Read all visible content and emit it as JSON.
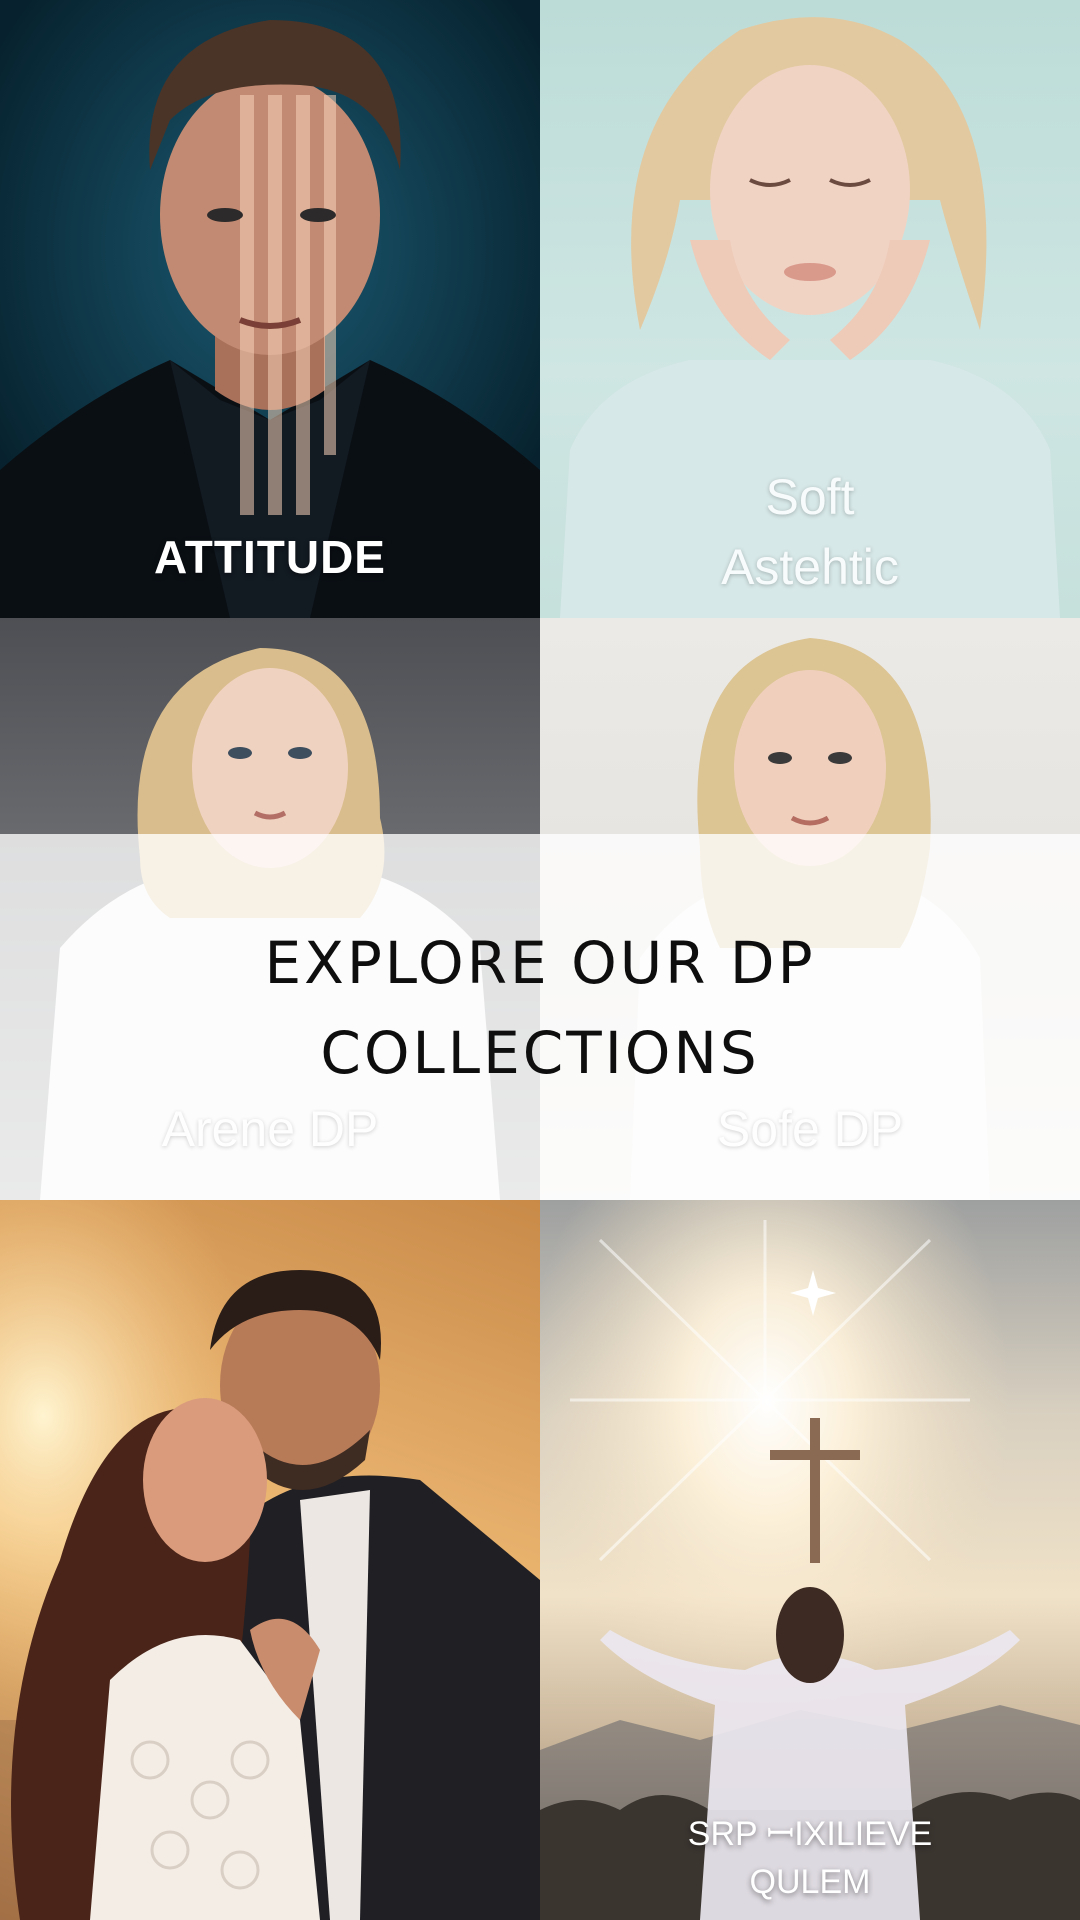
{
  "header": {
    "title": "EXPLORE OUR DP COLLECTIONS"
  },
  "collections": [
    {
      "label": "ATTITUDE",
      "theme": "attitude"
    },
    {
      "label": "Soft\nAstehtic",
      "theme": "soft-aesthetic"
    },
    {
      "label": "Arene DP",
      "theme": "arene"
    },
    {
      "label": "Sofe DP",
      "theme": "sofe"
    },
    {
      "label": "",
      "theme": "love-couple"
    },
    {
      "label": "SRP ꟷIXILIEVE\nQULEM",
      "theme": "believe"
    }
  ],
  "colors": {
    "overlay": "#ffffff",
    "title_text": "#0e0e0e",
    "label_text": "#ffffff"
  }
}
